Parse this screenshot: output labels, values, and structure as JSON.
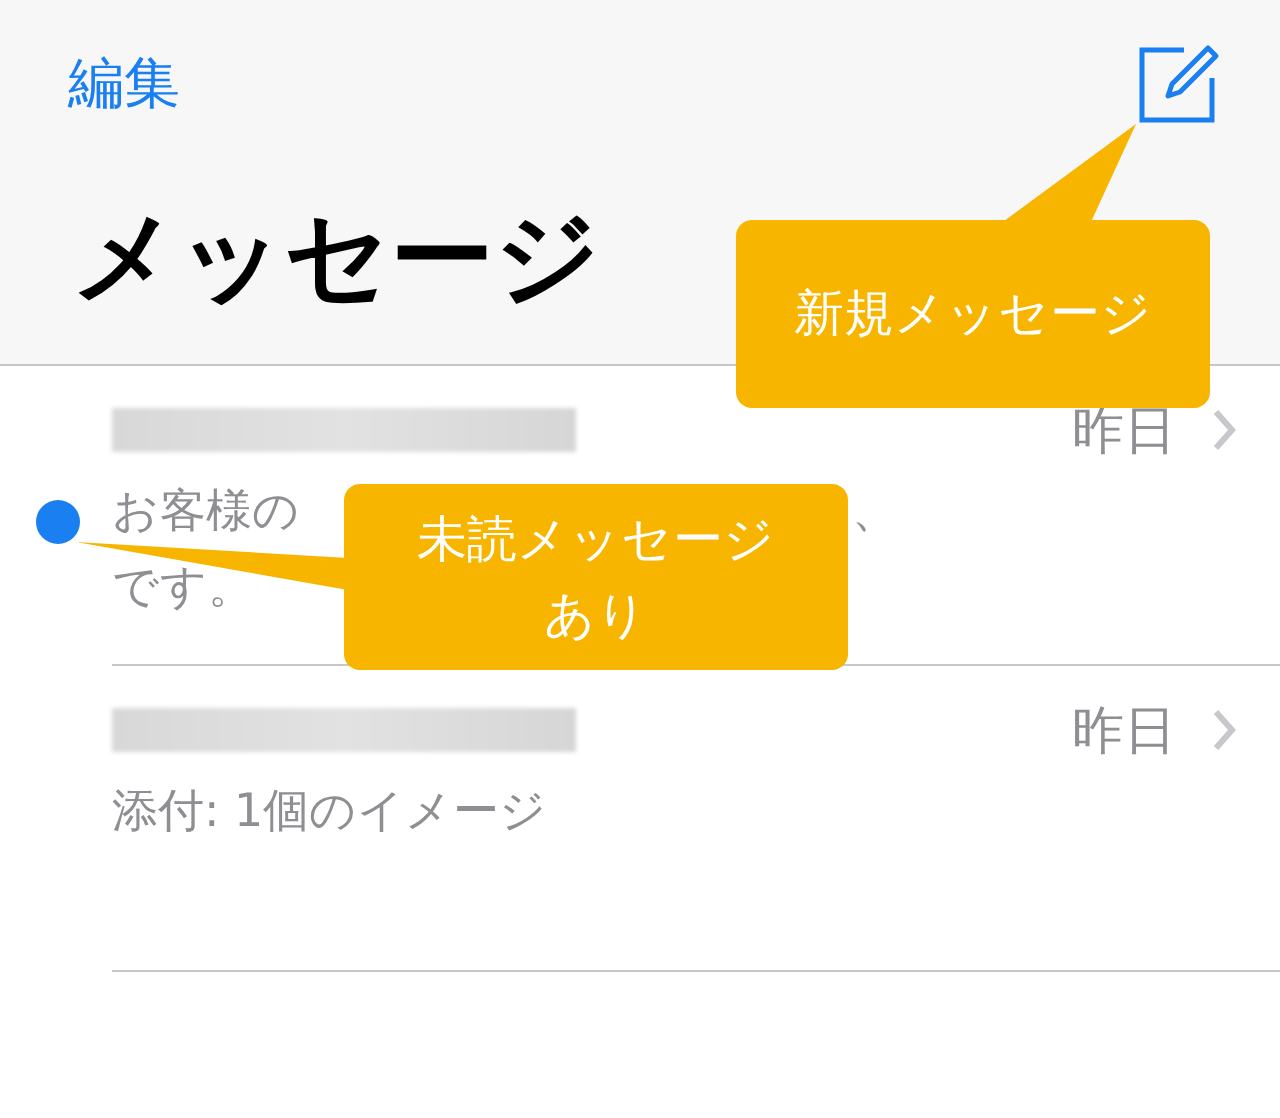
{
  "header": {
    "edit": "編集",
    "title": "メッセージ"
  },
  "conversations": [
    {
      "unread": true,
      "time": "昨日",
      "preview_lines": [
        [
          "お客様の",
          "、"
        ],
        [
          "です。"
        ]
      ]
    },
    {
      "unread": false,
      "time": "昨日",
      "preview_lines": [
        [
          "添付: 1個のイメージ"
        ]
      ]
    }
  ],
  "callouts": [
    {
      "kind": "compose",
      "lines": [
        "新規メッセージ"
      ]
    },
    {
      "kind": "unread",
      "lines": [
        "未読メッセージ",
        "あり"
      ]
    }
  ]
}
